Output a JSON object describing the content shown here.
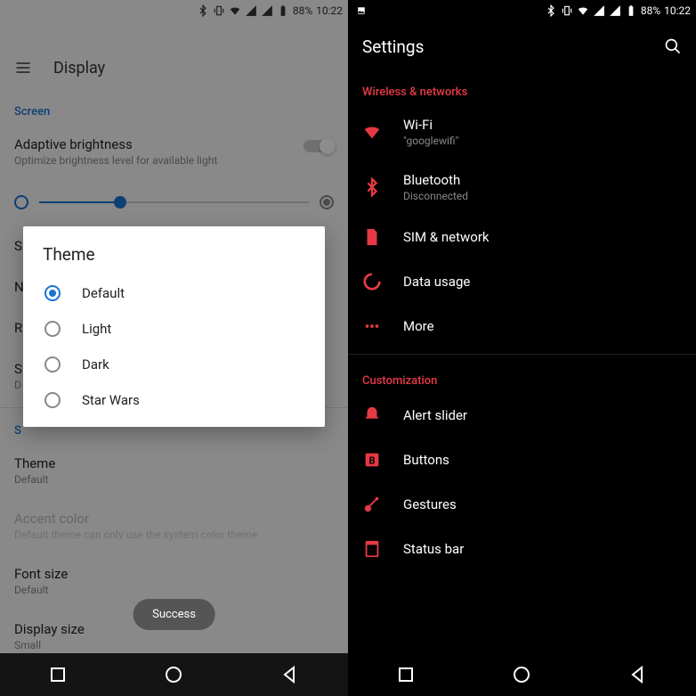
{
  "status": {
    "battery": "88%",
    "time": "10:22"
  },
  "left": {
    "header": "Display",
    "section_screen": "Screen",
    "adaptive": {
      "title": "Adaptive brightness",
      "sub": "Optimize brightness level for available light"
    },
    "items_bg": [
      {
        "title": "S"
      },
      {
        "title": "N"
      },
      {
        "title": "R"
      },
      {
        "title": "S",
        "sub": "D"
      }
    ],
    "section_sys": "S",
    "theme_row": {
      "title": "Theme",
      "sub": "Default"
    },
    "accent_row": {
      "title": "Accent color",
      "sub": "Default theme can only use the system color theme"
    },
    "font_row": {
      "title": "Font size",
      "sub": "Default"
    },
    "display_size_row": {
      "title": "Display size",
      "sub": "Small"
    },
    "dialog": {
      "title": "Theme",
      "options": [
        "Default",
        "Light",
        "Dark",
        "Star Wars"
      ],
      "selected": 0
    },
    "toast": "Success"
  },
  "right": {
    "header": "Settings",
    "section_wireless": "Wireless & networks",
    "wifi": {
      "title": "Wi-Fi",
      "sub": "\"googlewifi\""
    },
    "bluetooth": {
      "title": "Bluetooth",
      "sub": "Disconnected"
    },
    "sim": {
      "title": "SIM & network"
    },
    "data": {
      "title": "Data usage"
    },
    "more": {
      "title": "More"
    },
    "section_custom": "Customization",
    "alert": {
      "title": "Alert slider"
    },
    "buttons": {
      "title": "Buttons"
    },
    "gestures": {
      "title": "Gestures"
    },
    "statusbar": {
      "title": "Status bar"
    }
  }
}
